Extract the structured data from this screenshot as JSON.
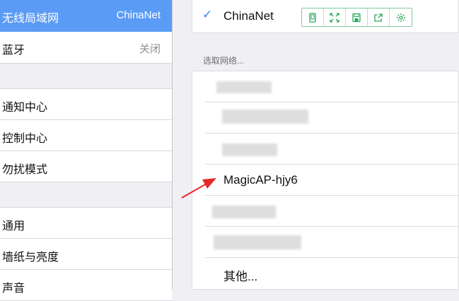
{
  "sidebar": {
    "items": [
      {
        "label": "无线局域网",
        "value": "ChinaNet"
      },
      {
        "label": "蓝牙",
        "value": "关闭"
      },
      {
        "label": "通知中心"
      },
      {
        "label": "控制中心"
      },
      {
        "label": "勿扰模式"
      },
      {
        "label": "通用"
      },
      {
        "label": "墙纸与亮度"
      },
      {
        "label": "声音"
      }
    ]
  },
  "wifi": {
    "current_network": "ChinaNet",
    "toolbar": {
      "icons": [
        "tablet-icon",
        "expand-icon",
        "save-icon",
        "share-icon",
        "gear-icon"
      ]
    },
    "section_label": "选取网络...",
    "networks": [
      {
        "name": "",
        "blurred": true
      },
      {
        "name": "",
        "blurred": true
      },
      {
        "name": "",
        "blurred": true
      },
      {
        "name": "MagicAP-hjy6",
        "blurred": false
      },
      {
        "name": "",
        "blurred": true
      },
      {
        "name": "",
        "blurred": true
      },
      {
        "name": "其他...",
        "blurred": false
      }
    ]
  },
  "colors": {
    "selection": "#5a9bf6",
    "check": "#3b86f5",
    "toolbar_green": "#2aa65a",
    "arrow": "#e52a2a"
  }
}
